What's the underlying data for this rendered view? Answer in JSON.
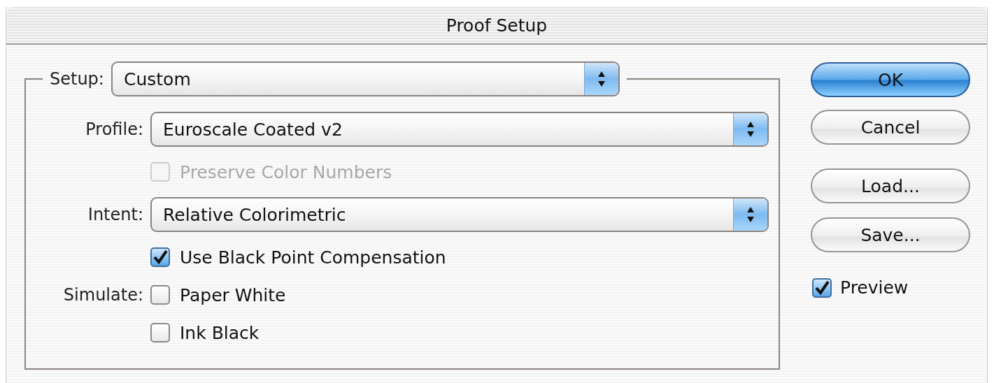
{
  "window": {
    "title": "Proof Setup"
  },
  "setup": {
    "label": "Setup:",
    "value": "Custom"
  },
  "rows": [
    {
      "kind": "popup",
      "label": "Profile:",
      "value": "Euroscale Coated v2"
    },
    {
      "kind": "checkbox",
      "label": "Preserve Color Numbers",
      "checked": false,
      "disabled": true
    },
    {
      "kind": "popup",
      "label": "Intent:",
      "value": "Relative Colorimetric"
    },
    {
      "kind": "checkbox",
      "label": "Use Black Point Compensation",
      "checked": true,
      "disabled": false
    },
    {
      "kind": "checkbox",
      "caption": "Simulate:",
      "label": "Paper White",
      "checked": false,
      "disabled": false
    },
    {
      "kind": "checkbox",
      "label": "Ink Black",
      "checked": false,
      "disabled": false
    }
  ],
  "buttons": [
    {
      "label": "OK",
      "default": true
    },
    {
      "label": "Cancel",
      "default": false
    },
    {
      "label": "Load...",
      "default": false
    },
    {
      "label": "Save...",
      "default": false
    }
  ],
  "preview": {
    "label": "Preview",
    "checked": true
  }
}
